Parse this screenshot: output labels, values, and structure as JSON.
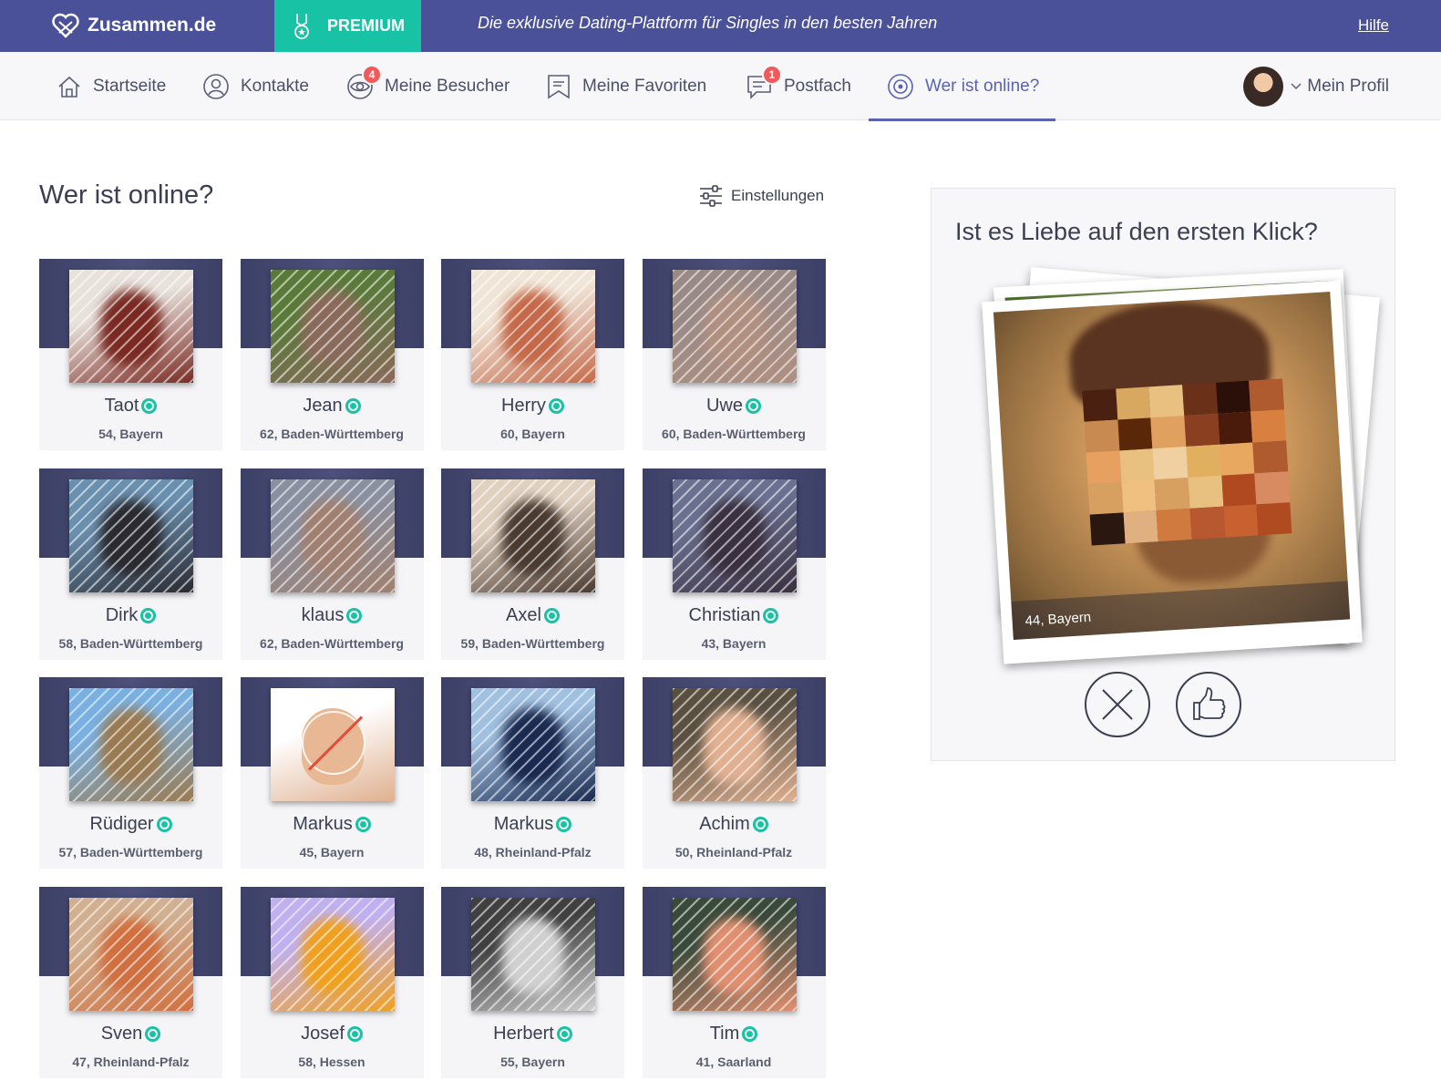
{
  "header": {
    "brand": "Zusammen.de",
    "premium": "PREMIUM",
    "tagline": "Die exklusive Dating-Plattform für Singles in den besten Jahren",
    "help": "Hilfe"
  },
  "nav": {
    "items": [
      {
        "label": "Startseite",
        "icon": "home-icon"
      },
      {
        "label": "Kontakte",
        "icon": "user-circle-icon"
      },
      {
        "label": "Meine Besucher",
        "icon": "eye-icon",
        "badge": "4"
      },
      {
        "label": "Meine Favoriten",
        "icon": "bookmark-icon"
      },
      {
        "label": "Postfach",
        "icon": "chat-icon",
        "badge": "1"
      },
      {
        "label": "Wer ist online?",
        "icon": "online-radar-icon",
        "active": true
      }
    ],
    "profile": "Mein Profil"
  },
  "main": {
    "title": "Wer ist online?",
    "settings": "Einstellungen"
  },
  "members": [
    {
      "name": "Taot",
      "sub": "54, Bayern"
    },
    {
      "name": "Jean",
      "sub": "62, Baden-Württemberg"
    },
    {
      "name": "Herry",
      "sub": "60, Bayern"
    },
    {
      "name": "Uwe",
      "sub": "60, Baden-Württemberg"
    },
    {
      "name": "Dirk",
      "sub": "58, Baden-Württemberg"
    },
    {
      "name": "klaus",
      "sub": "62, Baden-Württemberg"
    },
    {
      "name": "Axel",
      "sub": "59, Baden-Württemberg"
    },
    {
      "name": "Christian",
      "sub": "43, Bayern"
    },
    {
      "name": "Rüdiger",
      "sub": "57, Baden-Württemberg"
    },
    {
      "name": "Markus",
      "sub": "45, Bayern"
    },
    {
      "name": "Markus",
      "sub": "48, Rheinland-Pfalz"
    },
    {
      "name": "Achim",
      "sub": "50, Rheinland-Pfalz"
    },
    {
      "name": "Sven",
      "sub": "47, Rheinland-Pfalz"
    },
    {
      "name": "Josef",
      "sub": "58, Hessen"
    },
    {
      "name": "Herbert",
      "sub": "55, Bayern"
    },
    {
      "name": "Tim",
      "sub": "41, Saarland"
    }
  ],
  "panel": {
    "title": "Ist es Liebe auf den ersten Klick?",
    "caption": "44, Bayern"
  },
  "colors": {
    "topbar": "#4a5199",
    "accent": "#18c3a5",
    "active_nav": "#5a62b2",
    "badge": "#f05a5a"
  }
}
